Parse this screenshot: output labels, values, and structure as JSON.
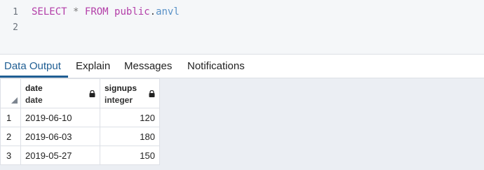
{
  "editor": {
    "line_numbers": [
      "1",
      "2"
    ],
    "query": {
      "select": "SELECT",
      "star": "*",
      "from": "FROM",
      "schema": "public",
      "dot": ".",
      "table": "anvl"
    }
  },
  "tabs": [
    {
      "label": "Data Output",
      "active": true
    },
    {
      "label": "Explain",
      "active": false
    },
    {
      "label": "Messages",
      "active": false
    },
    {
      "label": "Notifications",
      "active": false
    }
  ],
  "grid": {
    "columns": [
      {
        "name": "date",
        "type": "date"
      },
      {
        "name": "signups",
        "type": "integer"
      }
    ],
    "rows": [
      {
        "num": "1",
        "date": "2019-06-10",
        "signups": "120"
      },
      {
        "num": "2",
        "date": "2019-06-03",
        "signups": "180"
      },
      {
        "num": "3",
        "date": "2019-05-27",
        "signups": "150"
      }
    ]
  },
  "colors": {
    "accent": "#1f5e93",
    "keyword": "#b33ea8",
    "identifier": "#5891c7"
  }
}
